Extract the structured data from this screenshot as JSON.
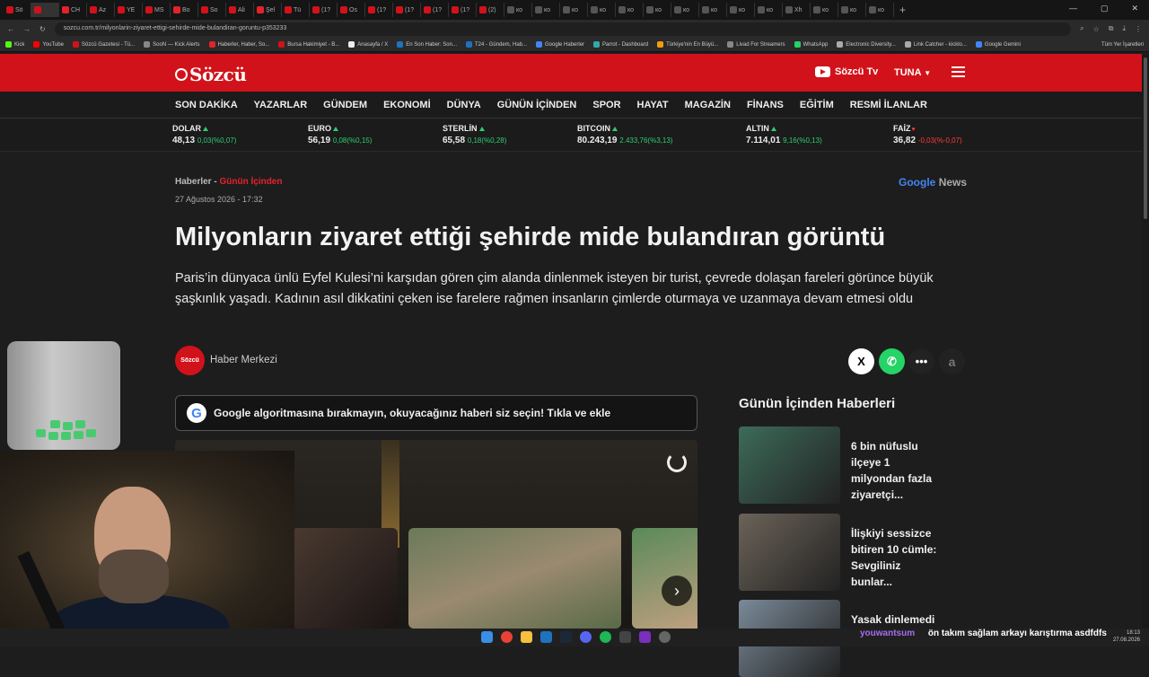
{
  "browser": {
    "tabs": [
      "Sö",
      "",
      "CH",
      "Az",
      "YE",
      "MS",
      "Bo",
      "So",
      "Ali",
      "Şel",
      "Tü",
      "(1?",
      "Os",
      "(1?",
      "(1?",
      "(1?",
      "(1?",
      "(2)",
      "ко",
      "ко",
      "ко",
      "ко",
      "ко",
      "ко",
      "ко",
      "ко",
      "ко",
      "ко",
      "Xh",
      "ко",
      "ко",
      "ко"
    ],
    "tab_colors": [
      "#d2121a",
      "#d2121a",
      "#e4222b",
      "#d2121a",
      "#d2121a",
      "#d2121a",
      "#e4222b",
      "#d2121a",
      "#d2121a",
      "#e4222b",
      "#d2121a",
      "#d2121a",
      "#d2121a",
      "#d2121a",
      "#d2121a",
      "#d2121a",
      "#d2121a",
      "#d2121a",
      "#555",
      "#555",
      "#555",
      "#555",
      "#555",
      "#555",
      "#555",
      "#555",
      "#555",
      "#555",
      "#555",
      "#555",
      "#555",
      "#555"
    ],
    "url": "sozcu.com.tr/milyonlarin-ziyaret-ettigi-sehirde-mide-bulandiran-goruntu-p353233",
    "bookmarks": [
      {
        "label": "Kick",
        "color": "#53fc18"
      },
      {
        "label": "YouTube",
        "color": "#ff0000"
      },
      {
        "label": "Sözcü Gazetesi - Tü...",
        "color": "#d2121a"
      },
      {
        "label": "SooN — Kick Alerts",
        "color": "#888"
      },
      {
        "label": "Haberler, Haber, So...",
        "color": "#e4222b"
      },
      {
        "label": "Bursa Hakimiyet - B...",
        "color": "#d2121a"
      },
      {
        "label": "Anasayfa / X",
        "color": "#eee"
      },
      {
        "label": "En Son Haber: Son...",
        "color": "#1e73be"
      },
      {
        "label": "T24 - Gündem, Hab...",
        "color": "#1e73be"
      },
      {
        "label": "Google Haberler",
        "color": "#4285f4"
      },
      {
        "label": "Parrot - Dashboard",
        "color": "#3aa"
      },
      {
        "label": "Türkiye'nin En Büyü...",
        "color": "#f39c12"
      },
      {
        "label": "Livad For Streamers",
        "color": "#888"
      },
      {
        "label": "WhatsApp",
        "color": "#25d366"
      },
      {
        "label": "Electronic Diversity...",
        "color": "#aaa"
      },
      {
        "label": "Link Catcher - kicklo...",
        "color": "#aaa"
      },
      {
        "label": "Google Gemini",
        "color": "#4285f4"
      }
    ],
    "all_bookmarks": "Tüm Yer İşaretleri"
  },
  "site": {
    "logo_text": "Sözcü",
    "tv_label": "Sözcü Tv",
    "user_label": "TUNA",
    "nav": [
      "SON DAKİKA",
      "YAZARLAR",
      "GÜNDEM",
      "EKONOMİ",
      "DÜNYA",
      "GÜNÜN İÇİNDEN",
      "SPOR",
      "HAYAT",
      "MAGAZİN",
      "FİNANS",
      "EĞİTİM",
      "RESMİ İLANLAR"
    ],
    "markets": [
      {
        "name": "DOLAR",
        "value": "48,13",
        "change": "0,03(%0,07)",
        "dir": "up"
      },
      {
        "name": "EURO",
        "value": "56,19",
        "change": "0,08(%0,15)",
        "dir": "up"
      },
      {
        "name": "STERLİN",
        "value": "65,58",
        "change": "0,18(%0,28)",
        "dir": "up"
      },
      {
        "name": "BITCOIN",
        "value": "80.243,19",
        "change": "2.433,76(%3,13)",
        "dir": "up"
      },
      {
        "name": "ALTIN",
        "value": "7.114,01",
        "change": "9,16(%0,13)",
        "dir": "up"
      },
      {
        "name": "FAİZ",
        "value": "36,82",
        "change": "-0,03(%-0,07)",
        "dir": "down"
      }
    ]
  },
  "article": {
    "breadcrumb_home": "Haberler",
    "breadcrumb_sep": "-",
    "breadcrumb_section": "Günün İçinden",
    "date": "27 Ağustos 2026 - 17:32",
    "google_news": {
      "google": "Google",
      "news": "News"
    },
    "headline": "Milyonların ziyaret ettiği şehirde mide bulandıran görüntü",
    "summary": "Paris’in dünyaca ünlü Eyfel Kulesi’ni karşıdan gören çim alanda dinlenmek isteyen bir turist, çevrede dolaşan fareleri görünce büyük şaşkınlık yaşadı. Kadının asıl dikkatini çeken ise farelere rağmen insanların çimlerde oturmaya ve uzanmaya devam etmesi oldu",
    "author_badge": "Sözcü",
    "author": "Haber Merkezi",
    "share": {
      "x": "X",
      "font": "a"
    },
    "google_banner": "Google algoritmasına bırakmayın, okuyacağınız haberi siz seçin! Tıkla ve ekle",
    "google_badge": "G"
  },
  "sidebar": {
    "heading": "Günün İçinden Haberleri",
    "items": [
      {
        "title": "6 bin nüfuslu ilçeye 1 milyondan fazla ziyaretçi...",
        "color": "#3d6b5a"
      },
      {
        "title": "İlişkiyi sessizce bitiren 10 cümle: Sevgiliniz bunlar...",
        "color": "#6b6358"
      },
      {
        "title": "Yasak dinlemedi",
        "color": "#7a8a99"
      }
    ]
  },
  "stream": {
    "chat_user": "youwantsum",
    "chat_message": "ön takım sağlam arkayı karıştırma asdfdfs",
    "clock_time": "18:13",
    "clock_date": "27.08.2026"
  }
}
